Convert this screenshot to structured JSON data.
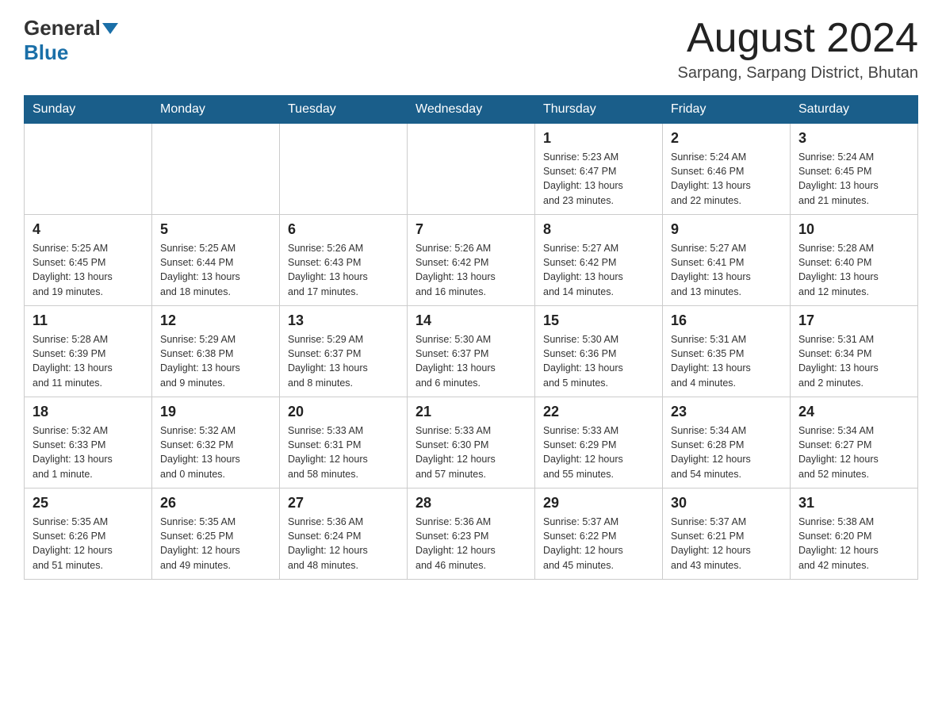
{
  "header": {
    "logo_general": "General",
    "logo_blue": "Blue",
    "month_title": "August 2024",
    "location": "Sarpang, Sarpang District, Bhutan"
  },
  "weekdays": [
    "Sunday",
    "Monday",
    "Tuesday",
    "Wednesday",
    "Thursday",
    "Friday",
    "Saturday"
  ],
  "weeks": [
    [
      {
        "day": "",
        "info": ""
      },
      {
        "day": "",
        "info": ""
      },
      {
        "day": "",
        "info": ""
      },
      {
        "day": "",
        "info": ""
      },
      {
        "day": "1",
        "info": "Sunrise: 5:23 AM\nSunset: 6:47 PM\nDaylight: 13 hours\nand 23 minutes."
      },
      {
        "day": "2",
        "info": "Sunrise: 5:24 AM\nSunset: 6:46 PM\nDaylight: 13 hours\nand 22 minutes."
      },
      {
        "day": "3",
        "info": "Sunrise: 5:24 AM\nSunset: 6:45 PM\nDaylight: 13 hours\nand 21 minutes."
      }
    ],
    [
      {
        "day": "4",
        "info": "Sunrise: 5:25 AM\nSunset: 6:45 PM\nDaylight: 13 hours\nand 19 minutes."
      },
      {
        "day": "5",
        "info": "Sunrise: 5:25 AM\nSunset: 6:44 PM\nDaylight: 13 hours\nand 18 minutes."
      },
      {
        "day": "6",
        "info": "Sunrise: 5:26 AM\nSunset: 6:43 PM\nDaylight: 13 hours\nand 17 minutes."
      },
      {
        "day": "7",
        "info": "Sunrise: 5:26 AM\nSunset: 6:42 PM\nDaylight: 13 hours\nand 16 minutes."
      },
      {
        "day": "8",
        "info": "Sunrise: 5:27 AM\nSunset: 6:42 PM\nDaylight: 13 hours\nand 14 minutes."
      },
      {
        "day": "9",
        "info": "Sunrise: 5:27 AM\nSunset: 6:41 PM\nDaylight: 13 hours\nand 13 minutes."
      },
      {
        "day": "10",
        "info": "Sunrise: 5:28 AM\nSunset: 6:40 PM\nDaylight: 13 hours\nand 12 minutes."
      }
    ],
    [
      {
        "day": "11",
        "info": "Sunrise: 5:28 AM\nSunset: 6:39 PM\nDaylight: 13 hours\nand 11 minutes."
      },
      {
        "day": "12",
        "info": "Sunrise: 5:29 AM\nSunset: 6:38 PM\nDaylight: 13 hours\nand 9 minutes."
      },
      {
        "day": "13",
        "info": "Sunrise: 5:29 AM\nSunset: 6:37 PM\nDaylight: 13 hours\nand 8 minutes."
      },
      {
        "day": "14",
        "info": "Sunrise: 5:30 AM\nSunset: 6:37 PM\nDaylight: 13 hours\nand 6 minutes."
      },
      {
        "day": "15",
        "info": "Sunrise: 5:30 AM\nSunset: 6:36 PM\nDaylight: 13 hours\nand 5 minutes."
      },
      {
        "day": "16",
        "info": "Sunrise: 5:31 AM\nSunset: 6:35 PM\nDaylight: 13 hours\nand 4 minutes."
      },
      {
        "day": "17",
        "info": "Sunrise: 5:31 AM\nSunset: 6:34 PM\nDaylight: 13 hours\nand 2 minutes."
      }
    ],
    [
      {
        "day": "18",
        "info": "Sunrise: 5:32 AM\nSunset: 6:33 PM\nDaylight: 13 hours\nand 1 minute."
      },
      {
        "day": "19",
        "info": "Sunrise: 5:32 AM\nSunset: 6:32 PM\nDaylight: 13 hours\nand 0 minutes."
      },
      {
        "day": "20",
        "info": "Sunrise: 5:33 AM\nSunset: 6:31 PM\nDaylight: 12 hours\nand 58 minutes."
      },
      {
        "day": "21",
        "info": "Sunrise: 5:33 AM\nSunset: 6:30 PM\nDaylight: 12 hours\nand 57 minutes."
      },
      {
        "day": "22",
        "info": "Sunrise: 5:33 AM\nSunset: 6:29 PM\nDaylight: 12 hours\nand 55 minutes."
      },
      {
        "day": "23",
        "info": "Sunrise: 5:34 AM\nSunset: 6:28 PM\nDaylight: 12 hours\nand 54 minutes."
      },
      {
        "day": "24",
        "info": "Sunrise: 5:34 AM\nSunset: 6:27 PM\nDaylight: 12 hours\nand 52 minutes."
      }
    ],
    [
      {
        "day": "25",
        "info": "Sunrise: 5:35 AM\nSunset: 6:26 PM\nDaylight: 12 hours\nand 51 minutes."
      },
      {
        "day": "26",
        "info": "Sunrise: 5:35 AM\nSunset: 6:25 PM\nDaylight: 12 hours\nand 49 minutes."
      },
      {
        "day": "27",
        "info": "Sunrise: 5:36 AM\nSunset: 6:24 PM\nDaylight: 12 hours\nand 48 minutes."
      },
      {
        "day": "28",
        "info": "Sunrise: 5:36 AM\nSunset: 6:23 PM\nDaylight: 12 hours\nand 46 minutes."
      },
      {
        "day": "29",
        "info": "Sunrise: 5:37 AM\nSunset: 6:22 PM\nDaylight: 12 hours\nand 45 minutes."
      },
      {
        "day": "30",
        "info": "Sunrise: 5:37 AM\nSunset: 6:21 PM\nDaylight: 12 hours\nand 43 minutes."
      },
      {
        "day": "31",
        "info": "Sunrise: 5:38 AM\nSunset: 6:20 PM\nDaylight: 12 hours\nand 42 minutes."
      }
    ]
  ]
}
